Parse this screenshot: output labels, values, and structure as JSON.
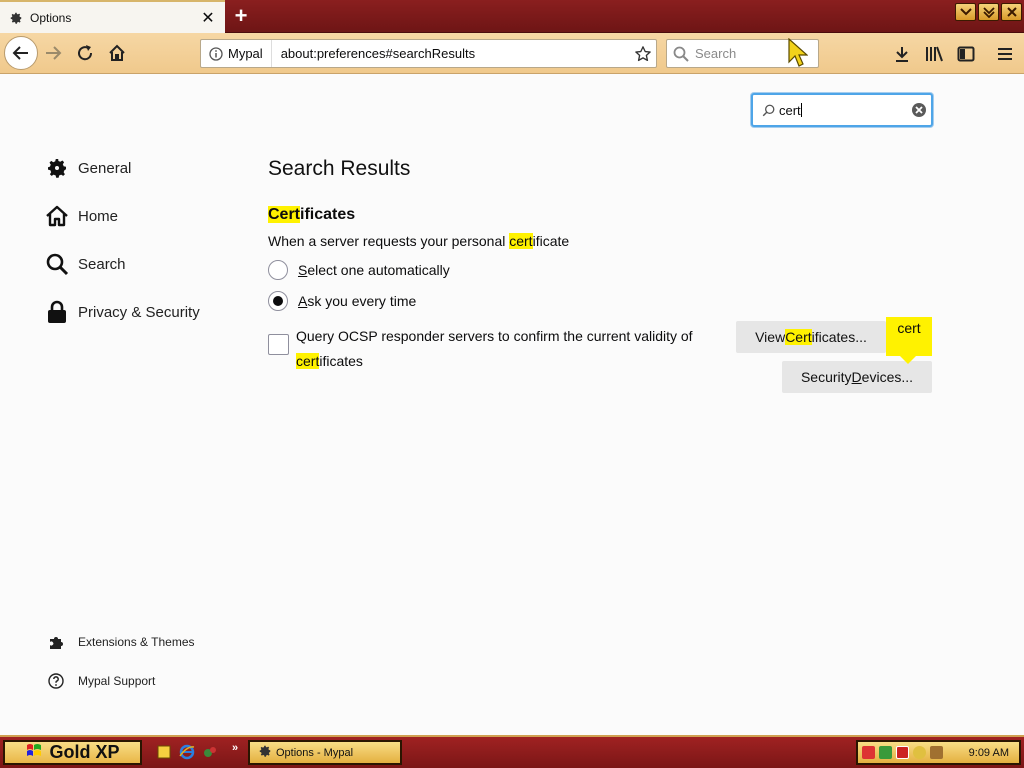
{
  "tab": {
    "title": "Options",
    "icon": "gear-icon",
    "close_icon": "close-icon"
  },
  "window_controls": [
    "minimize-icon",
    "restore-icon",
    "close-icon"
  ],
  "navbar": {
    "identity_label": "Mypal",
    "url": "about:preferences#searchResults",
    "search_placeholder": "Search"
  },
  "find_in_options": {
    "value": "cert"
  },
  "categories": [
    {
      "label": "General",
      "icon": "gear-icon"
    },
    {
      "label": "Home",
      "icon": "home-icon"
    },
    {
      "label": "Search",
      "icon": "search-icon"
    },
    {
      "label": "Privacy & Security",
      "icon": "lock-icon"
    }
  ],
  "footer_links": [
    {
      "label": "Extensions & Themes",
      "icon": "puzzle-icon"
    },
    {
      "label": "Mypal Support",
      "icon": "help-icon"
    }
  ],
  "results": {
    "title": "Search Results",
    "group_title_hl": "Cert",
    "group_title_rest": "ificates",
    "desc_pre": "When a server requests your personal ",
    "desc_hl": "cert",
    "desc_post": "ificate",
    "radio_options": [
      {
        "access": "S",
        "rest": "elect one automatically",
        "checked": false
      },
      {
        "access": "A",
        "rest": "sk you every time",
        "checked": true
      }
    ],
    "ocsp": {
      "line1": "Query OCSP responder servers to confirm the current validity of",
      "line2_hl": "cert",
      "line2_rest": "ificates",
      "checked": false
    },
    "view_certs": {
      "pre": "View ",
      "hl": "Cert",
      "post": "ificates..."
    },
    "security_devices": {
      "pre": "Security ",
      "access": "D",
      "post": "evices..."
    },
    "callout": "cert"
  },
  "taskbar": {
    "start_label": "Gold XP",
    "task_item": "Options - Mypal",
    "clock": "9:09 AM"
  }
}
